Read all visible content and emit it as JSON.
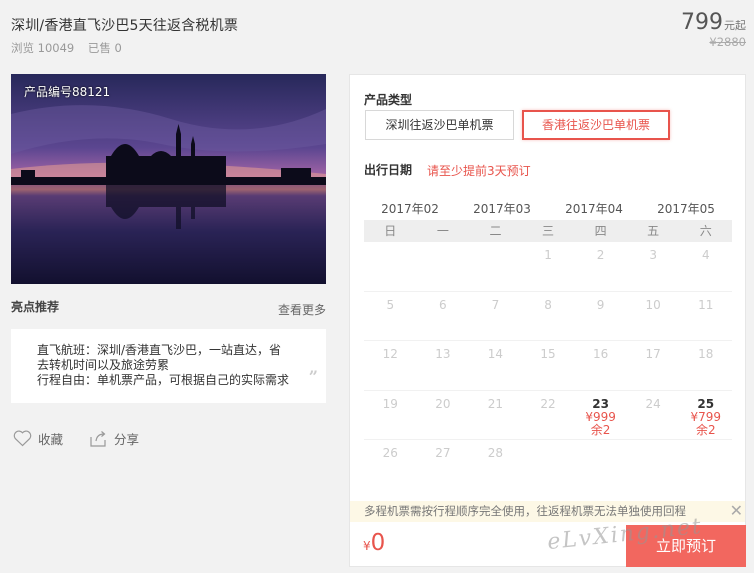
{
  "product": {
    "title": "深圳/香港直飞沙巴5天往返含税机票",
    "views_text": "浏览 10049",
    "sold_text": "已售 0",
    "price": "799",
    "price_unit": "元起",
    "original_price": "¥2880"
  },
  "photo": {
    "label": "产品编号88121"
  },
  "highlights": {
    "title": "亮点推荐",
    "more_link": "查看更多",
    "lines": [
      "直飞航班：深圳/香港直飞沙巴，一站直达，省去转机时间以及旅途劳累",
      "行程自由：单机票产品，可根据自己的实际需求"
    ]
  },
  "actions": {
    "favorite": "收藏",
    "share": "分享"
  },
  "booking": {
    "type_label": "产品类型",
    "types": [
      "深圳往返沙巴单机票",
      "香港往返沙巴单机票"
    ],
    "selected_type": 1,
    "date_label": "出行日期",
    "date_hint": "请至少提前3天预订",
    "months": [
      "2017年02",
      "2017年03",
      "2017年04",
      "2017年05"
    ],
    "weekdays": [
      "日",
      "一",
      "二",
      "三",
      "四",
      "五",
      "六"
    ],
    "calendar_rows": [
      [
        {
          "d": ""
        },
        {
          "d": ""
        },
        {
          "d": ""
        },
        {
          "d": "1"
        },
        {
          "d": "2"
        },
        {
          "d": "3"
        },
        {
          "d": "4"
        }
      ],
      [
        {
          "d": "5"
        },
        {
          "d": "6"
        },
        {
          "d": "7"
        },
        {
          "d": "8"
        },
        {
          "d": "9"
        },
        {
          "d": "10"
        },
        {
          "d": "11"
        }
      ],
      [
        {
          "d": "12"
        },
        {
          "d": "13"
        },
        {
          "d": "14"
        },
        {
          "d": "15"
        },
        {
          "d": "16"
        },
        {
          "d": "17"
        },
        {
          "d": "18"
        }
      ],
      [
        {
          "d": "19"
        },
        {
          "d": "20"
        },
        {
          "d": "21"
        },
        {
          "d": "22"
        },
        {
          "d": "23",
          "price": "¥999",
          "remain": "余2"
        },
        {
          "d": "24"
        },
        {
          "d": "25",
          "price": "¥799",
          "remain": "余2"
        }
      ],
      [
        {
          "d": "26"
        },
        {
          "d": "27"
        },
        {
          "d": "28"
        },
        {
          "d": ""
        },
        {
          "d": ""
        },
        {
          "d": ""
        },
        {
          "d": ""
        }
      ]
    ],
    "notice": "多程机票需按行程顺序完全使用，往返程机票无法单独使用回程",
    "close_glyph": "✕",
    "total_currency": "¥",
    "total_amount": "0",
    "book_button": "立即预订",
    "accent_color": "#e8544c"
  },
  "watermark": "eLvXing.net"
}
